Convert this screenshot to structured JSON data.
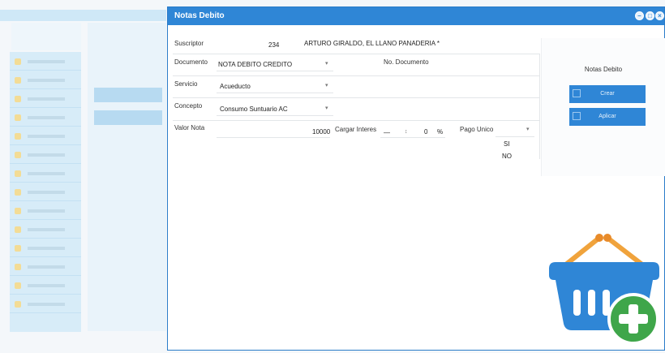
{
  "window": {
    "title": "Notas Debito",
    "controls": [
      "minimize-icon",
      "maximize-icon",
      "close-icon"
    ]
  },
  "form": {
    "subscriber_label": "Suscriptor",
    "subscriber_id": "234",
    "subscriber_name": "ARTURO GIRALDO, EL LLANO PANADERIA *",
    "document_label": "Documento",
    "document_value": "NOTA DEBITO CREDITO",
    "doc_no_label": "No. Documento",
    "service_label": "Servicio",
    "service_value": "Acueducto",
    "concept_label": "Concepto",
    "concept_value": "Consumo Suntuario AC",
    "note_value_label": "Valor Nota",
    "note_value": "10000",
    "interest_label": "Cargar Interes",
    "interest_unit": "%",
    "single_payment_label": "Pago Unico",
    "options": [
      "SI",
      "NO"
    ]
  },
  "side": {
    "title": "Notas Debito",
    "buttons": [
      "Crear",
      "Aplicar"
    ]
  },
  "icons": {
    "basket": "shopping-basket-add-icon",
    "basket_color": "#2f86d6",
    "plus_color": "#3fa64a",
    "handle_color": "#f0a33c"
  }
}
